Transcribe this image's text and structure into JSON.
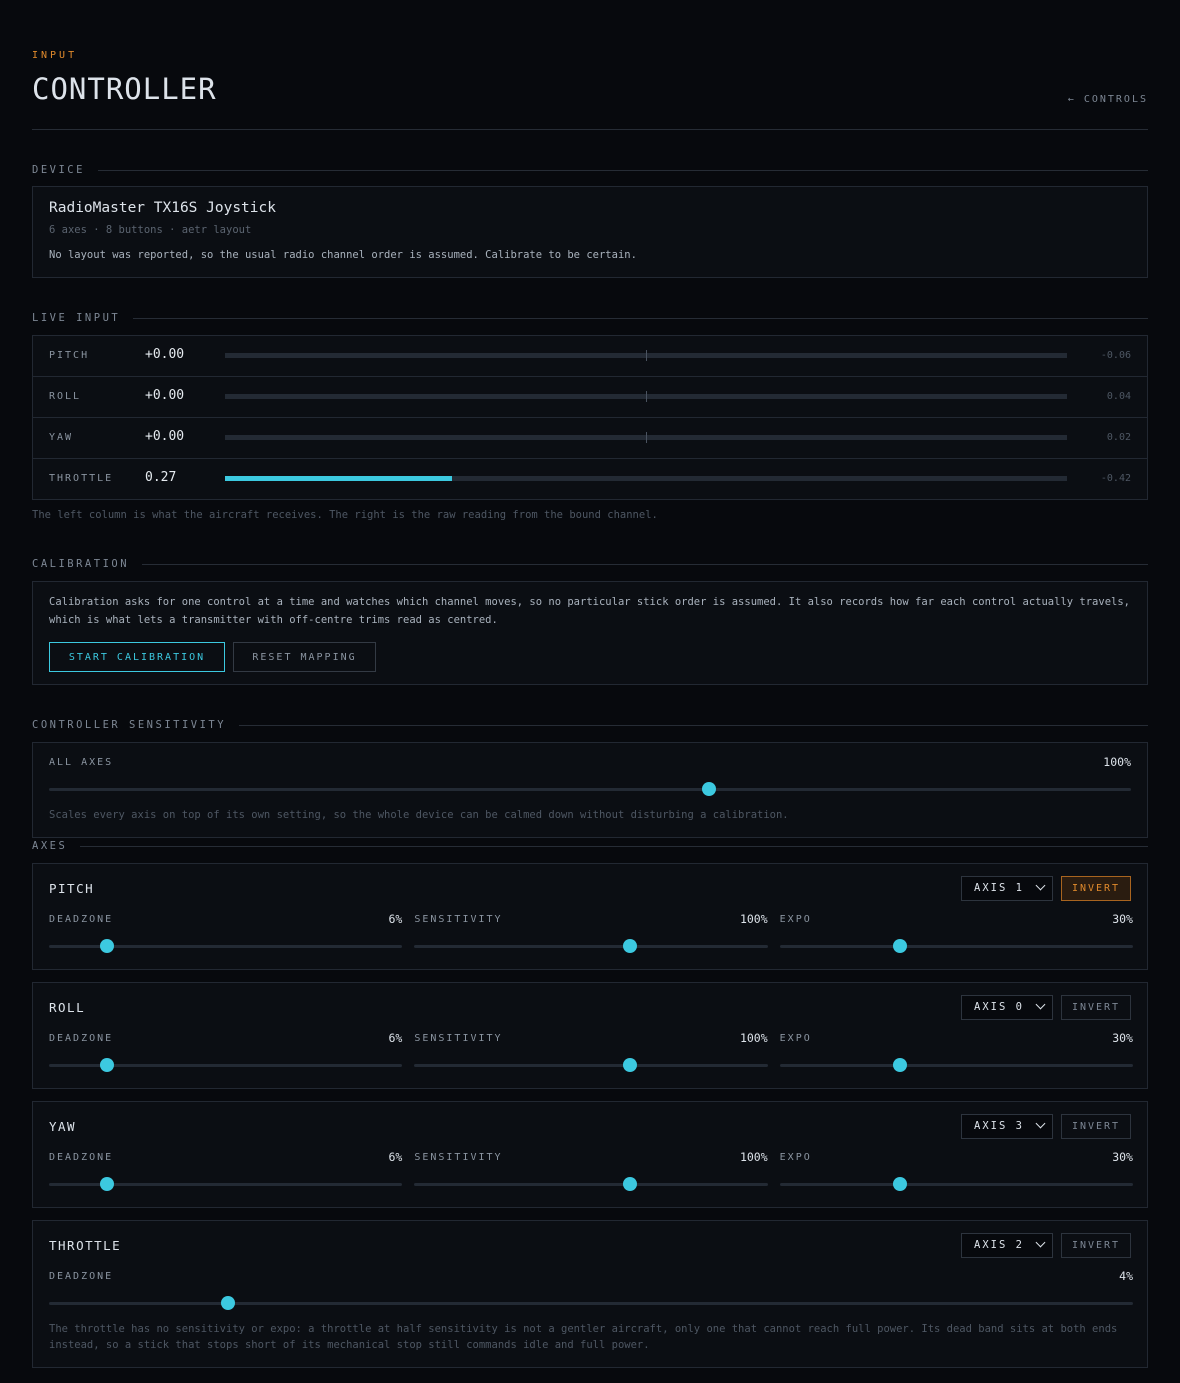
{
  "header": {
    "kicker": "INPUT",
    "title": "CONTROLLER",
    "back_link": "← CONTROLS"
  },
  "device": {
    "section_label": "DEVICE",
    "name": "RadioMaster TX16S Joystick",
    "meta": "6 axes · 8 buttons · aetr layout",
    "note": "No layout was reported, so the usual radio channel order is assumed. Calibrate to be certain."
  },
  "live_input": {
    "section_label": "LIVE INPUT",
    "rows": [
      {
        "name": "PITCH",
        "value": "+0.00",
        "raw": "-0.06",
        "bipolar": true,
        "level": 0.0
      },
      {
        "name": "ROLL",
        "value": "+0.00",
        "raw": "0.04",
        "bipolar": true,
        "level": 0.0
      },
      {
        "name": "YAW",
        "value": "+0.00",
        "raw": "0.02",
        "bipolar": true,
        "level": 0.0
      },
      {
        "name": "THROTTLE",
        "value": "0.27",
        "raw": "-0.42",
        "bipolar": false,
        "level": 0.27
      }
    ],
    "caption": "The left column is what the aircraft receives. The right is the raw reading from the bound channel."
  },
  "calibration": {
    "section_label": "CALIBRATION",
    "text": "Calibration asks for one control at a time and watches which channel moves, so no particular stick order is assumed. It also records how far each control actually travels, which is what lets a transmitter with off-centre trims read as centred.",
    "start_button": "START CALIBRATION",
    "reset_button": "RESET MAPPING"
  },
  "sensitivity": {
    "section_label": "CONTROLLER SENSITIVITY",
    "label": "ALL AXES",
    "value": "100%",
    "level": 0.61,
    "note": "Scales every axis on top of its own setting, so the whole device can be calmed down without disturbing a calibration."
  },
  "axes": {
    "section_label": "AXES",
    "items": [
      {
        "name": "PITCH",
        "axis": "AXIS 1",
        "invert_label": "INVERT",
        "inverted": true,
        "deadzone": {
          "label": "DEADZONE",
          "value": "6%",
          "level": 0.165
        },
        "sensitivity": {
          "label": "SENSITIVITY",
          "value": "100%",
          "level": 0.61
        },
        "expo": {
          "label": "EXPO",
          "value": "30%",
          "level": 0.34
        }
      },
      {
        "name": "ROLL",
        "axis": "AXIS 0",
        "invert_label": "INVERT",
        "inverted": false,
        "deadzone": {
          "label": "DEADZONE",
          "value": "6%",
          "level": 0.165
        },
        "sensitivity": {
          "label": "SENSITIVITY",
          "value": "100%",
          "level": 0.61
        },
        "expo": {
          "label": "EXPO",
          "value": "30%",
          "level": 0.34
        }
      },
      {
        "name": "YAW",
        "axis": "AXIS 3",
        "invert_label": "INVERT",
        "inverted": false,
        "deadzone": {
          "label": "DEADZONE",
          "value": "6%",
          "level": 0.165
        },
        "sensitivity": {
          "label": "SENSITIVITY",
          "value": "100%",
          "level": 0.61
        },
        "expo": {
          "label": "EXPO",
          "value": "30%",
          "level": 0.34
        }
      }
    ],
    "throttle": {
      "name": "THROTTLE",
      "axis": "AXIS 2",
      "invert_label": "INVERT",
      "inverted": false,
      "deadzone": {
        "label": "DEADZONE",
        "value": "4%",
        "level": 0.165
      },
      "note": "The throttle has no sensitivity or expo: a throttle at half sensitivity is not a gentler aircraft, only one that cannot reach full power. Its dead band sits at both ends instead, so a stick that stops short of its mechanical stop still commands idle and full power."
    }
  },
  "colors": {
    "accent": "#3cc9e0",
    "kicker": "#e08a2c",
    "background": "#07090d",
    "panel": "#0b0e13"
  }
}
